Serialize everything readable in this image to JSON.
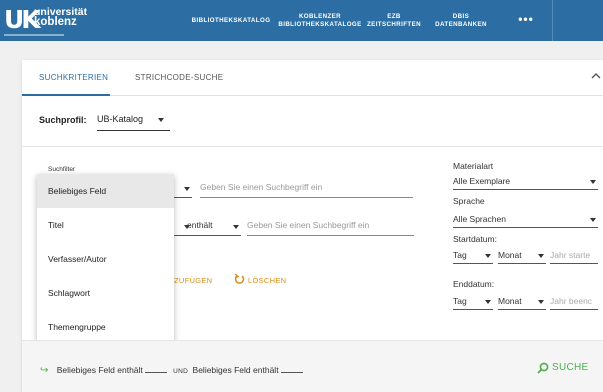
{
  "header": {
    "logo": {
      "mark": "UK",
      "line1": "universität",
      "line2": "koblenz"
    },
    "nav": [
      {
        "line1": "BIBLIOTHEKSKATALOG",
        "line2": ""
      },
      {
        "line1": "KOBLENZER",
        "line2": "BIBLIOTHEKSKATALOGE"
      },
      {
        "line1": "EZB",
        "line2": "ZEITSCHRIFTEN"
      },
      {
        "line1": "DBIS",
        "line2": "DATENBANKEN"
      }
    ],
    "more": "•••"
  },
  "tabs": [
    {
      "label": "SUCHKRITERIEN",
      "active": true
    },
    {
      "label": "STRICHCODE-SUCHE",
      "active": false
    }
  ],
  "profile": {
    "label": "Suchprofil:",
    "value": "UB-Katalog"
  },
  "filter": {
    "label": "Suchfilter",
    "row1": {
      "operator": "",
      "placeholder": "Geben Sie einen Suchbegriff ein"
    },
    "row2": {
      "operator": "enthält",
      "placeholder": "Geben Sie einen Suchbegriff ein"
    },
    "add_label": "ZUFÜGEN",
    "delete_label": "LÖSCHEN"
  },
  "dropdown": {
    "items": [
      "Beliebiges Feld",
      "Titel",
      "Verfasser/Autor",
      "Schlagwort",
      "Themengruppe"
    ],
    "selected_index": 0
  },
  "right": {
    "material_label": "Materialart",
    "material_value": "Alle Exemplare",
    "language_label": "Sprache",
    "language_value": "Alle Sprachen",
    "start_label": "Startdatum:",
    "end_label": "Enddatum:",
    "day": "Tag",
    "month": "Monat",
    "start_year_placeholder": "Jahr starte",
    "end_year_placeholder": "Jahr beenc"
  },
  "footer": {
    "field1": "Beliebiges Feld",
    "op1": "enthält",
    "und": "UND",
    "field2": "Beliebiges Feld",
    "op2": "enthält",
    "search_label": "SUCHE"
  },
  "colors": {
    "header": "#2c6ea3",
    "accent_orange": "#d98c1c",
    "accent_green": "#4caf50"
  }
}
